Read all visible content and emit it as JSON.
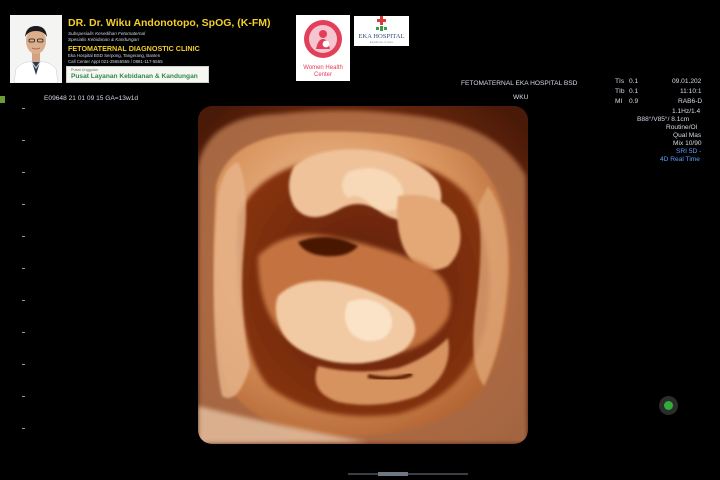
{
  "header": {
    "doctor_name": "DR. Dr. Wiku Andonotopo, SpOG, (K-FM)",
    "subtitle_line1": "Subspesialis Kesedihan Fetomaternal",
    "subtitle_line2": "Spesialis Kebidanan & Kandungan",
    "clinic_name": "FETOMATERNAL DIAGNOSTIC CLINIC",
    "address_line1": "Eka Hospital BSD Serpong, Tangerang, Banten",
    "address_line2": "Call Center Appt 021-25655555 / 0881-117-5555",
    "center_small": "Pusat Unggulan",
    "center_main": "Pusat Layanan Kebidanan & Kandungan",
    "whc_label_line1": "Women Health",
    "whc_label_line2": "Center",
    "eka_label": "EKA HOSPITAL",
    "eka_sub": "Excellence in Care"
  },
  "overlay": {
    "hospital": "FETOMATERNAL EKA HOSPITAL BSD",
    "operator": "WKU",
    "patient_line": "E09648   21 01 09 15   GA=13w1d",
    "date": "09.01.202",
    "time": "11:10:1",
    "probe": "RAB6-D",
    "params": [
      {
        "label": "TIs",
        "value": "0.1"
      },
      {
        "label": "TIb",
        "value": "0.1"
      },
      {
        "label": "MI",
        "value": "0.9"
      }
    ],
    "right_lines": [
      "1.1Hz/1.4",
      "B88°/V85°/ 8.1cm",
      "Routine/Ol",
      "Qual Mas",
      "Mix 10/90"
    ],
    "right_lines_blue": [
      "SRI 5D -",
      "4D Real Time"
    ]
  },
  "colors": {
    "brand_yellow": "#f2cf2a",
    "accent_green": "#2f8a4c",
    "overlay_blue": "#5e9cff"
  }
}
